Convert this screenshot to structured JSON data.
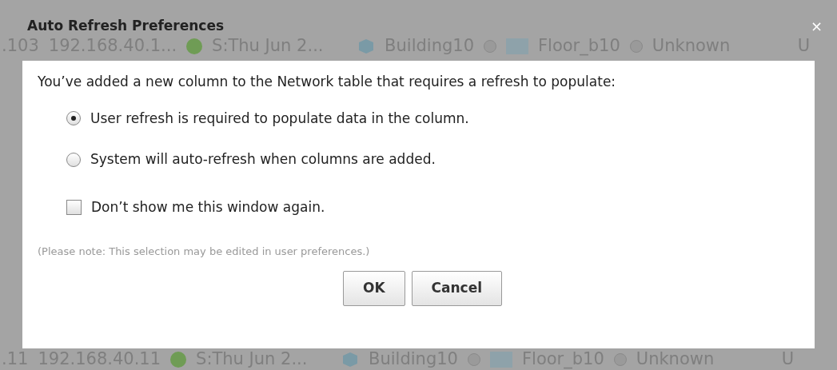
{
  "background_rows_top": [
    {
      "host": ".103",
      "ip": "192.168.40.1...",
      "status": "S:Thu Jun 2...",
      "building": "Building10",
      "floor": "Floor_b10",
      "type": "Unknown",
      "column_7": "U"
    }
  ],
  "dialog": {
    "title": "Auto Refresh Preferences",
    "close": "×",
    "message": "You’ve added a new column to the Network table that requires a refresh to populate:",
    "options": [
      {
        "label": "User refresh is required to populate data in the column.",
        "selected": true
      },
      {
        "label": "System will auto-refresh when columns are added.",
        "selected": false
      }
    ],
    "checkbox": {
      "label": "Don’t show me this window again.",
      "checked": false
    },
    "note": "(Please note: This selection may be edited in user preferences.)",
    "buttons": [
      {
        "label": "OK"
      },
      {
        "label": "Cancel"
      }
    ]
  },
  "background_rows_bottom": [
    {
      "host": ".11",
      "ip": "192.168.40.11",
      "status": "S:Thu Jun 2...",
      "building": "Building10",
      "floor": "Floor_b10",
      "type": "Unknown",
      "column_7": "U"
    }
  ]
}
